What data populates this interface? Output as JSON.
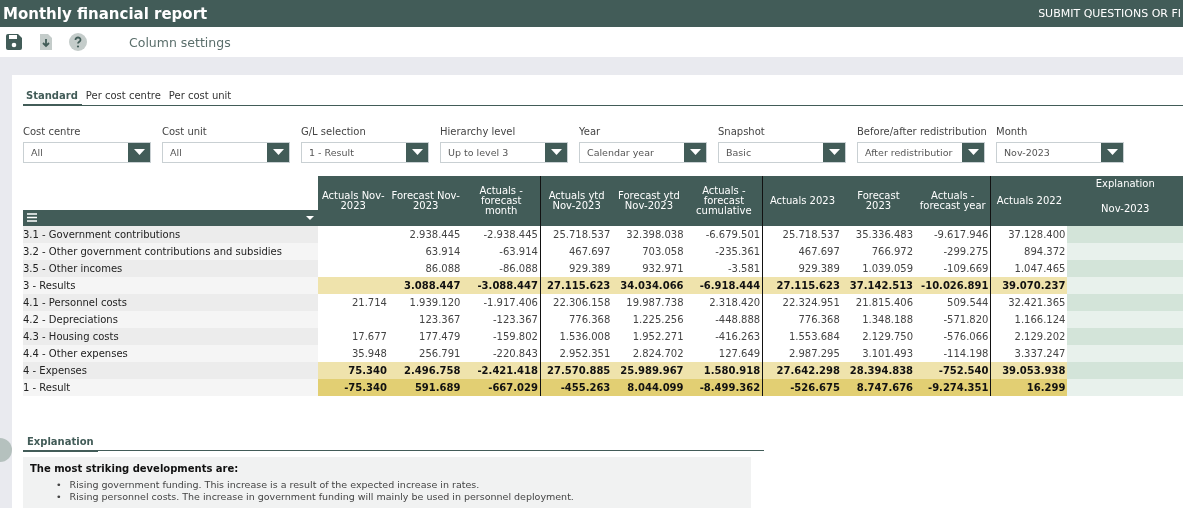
{
  "window": {
    "title": "Monthly financial report",
    "header_link": "SUBMIT QUESTIONS OR FI"
  },
  "toolbar": {
    "column_settings": "Column settings"
  },
  "tabs": [
    {
      "label": "Standard",
      "selected": true
    },
    {
      "label": "Per cost centre",
      "selected": false
    },
    {
      "label": "Per cost unit",
      "selected": false
    }
  ],
  "filters": [
    {
      "label": "Cost centre",
      "value": "All"
    },
    {
      "label": "Cost unit",
      "value": "All"
    },
    {
      "label": "G/L selection",
      "value": "1 - Result"
    },
    {
      "label": "Hierarchy level",
      "value": "Up to level 3"
    },
    {
      "label": "Year",
      "value": "Calendar year"
    },
    {
      "label": "Snapshot",
      "value": "Basic"
    },
    {
      "label": "Before/after redistribution",
      "value": "After redistributior"
    },
    {
      "label": "Month",
      "value": "Nov-2023"
    }
  ],
  "table": {
    "columns": [
      {
        "label": "Actuals Nov-2023",
        "divider": false
      },
      {
        "label": "Forecast Nov-2023",
        "divider": false
      },
      {
        "label": "Actuals - forecast month",
        "divider": true
      },
      {
        "label": "Actuals ytd Nov-2023",
        "divider": false
      },
      {
        "label": "Forecast ytd Nov-2023",
        "divider": false
      },
      {
        "label": "Actuals - forecast cumulative",
        "divider": true
      },
      {
        "label": "Actuals 2023",
        "divider": false
      },
      {
        "label": "Forecast 2023",
        "divider": false
      },
      {
        "label": "Actuals - forecast year",
        "divider": true
      },
      {
        "label": "Actuals 2022",
        "divider": false
      }
    ],
    "explanation_header": {
      "title": "Explanation",
      "subtitle": "Nov-2023"
    },
    "rows": [
      {
        "label": "3.1 - Government contributions",
        "kind": "detail",
        "cells": {
          "column_2": "2.938.445",
          "column_3": "-2.938.445",
          "column_4": "25.718.537",
          "column_5": "32.398.038",
          "column_6": "-6.679.501",
          "column_7": "25.718.537",
          "column_8": "35.336.483",
          "column_9": "-9.617.946",
          "column_10": "37.128.400"
        }
      },
      {
        "label": "3.2 - Other government contributions and subsidies",
        "kind": "detail",
        "cells": {
          "column_2": "63.914",
          "column_3": "-63.914",
          "column_4": "467.697",
          "column_5": "703.058",
          "column_6": "-235.361",
          "column_7": "467.697",
          "column_8": "766.972",
          "column_9": "-299.275",
          "column_10": "894.372"
        }
      },
      {
        "label": "3.5 - Other incomes",
        "kind": "detail",
        "cells": {
          "column_2": "86.088",
          "column_3": "-86.088",
          "column_4": "929.389",
          "column_5": "932.971",
          "column_6": "-3.581",
          "column_7": "929.389",
          "column_8": "1.039.059",
          "column_9": "-109.669",
          "column_10": "1.047.465"
        }
      },
      {
        "label": "3 - Results",
        "kind": "subtotal",
        "cells": {
          "column_2": "3.088.447",
          "column_3": "-3.088.447",
          "column_4": "27.115.623",
          "column_5": "34.034.066",
          "column_6": "-6.918.444",
          "column_7": "27.115.623",
          "column_8": "37.142.513",
          "column_9": "-10.026.891",
          "column_10": "39.070.237"
        }
      },
      {
        "label": "4.1 - Personnel costs",
        "kind": "detail",
        "cells": {
          "column_1": "21.714",
          "column_2": "1.939.120",
          "column_3": "-1.917.406",
          "column_4": "22.306.158",
          "column_5": "19.987.738",
          "column_6": "2.318.420",
          "column_7": "22.324.951",
          "column_8": "21.815.406",
          "column_9": "509.544",
          "column_10": "32.421.365"
        }
      },
      {
        "label": "4.2 - Depreciations",
        "kind": "detail",
        "cells": {
          "column_2": "123.367",
          "column_3": "-123.367",
          "column_4": "776.368",
          "column_5": "1.225.256",
          "column_6": "-448.888",
          "column_7": "776.368",
          "column_8": "1.348.188",
          "column_9": "-571.820",
          "column_10": "1.166.124"
        }
      },
      {
        "label": "4.3 - Housing costs",
        "kind": "detail",
        "cells": {
          "column_1": "17.677",
          "column_2": "177.479",
          "column_3": "-159.802",
          "column_4": "1.536.008",
          "column_5": "1.952.271",
          "column_6": "-416.263",
          "column_7": "1.553.684",
          "column_8": "2.129.750",
          "column_9": "-576.066",
          "column_10": "2.129.202"
        }
      },
      {
        "label": "4.4 - Other expenses",
        "kind": "detail",
        "cells": {
          "column_1": "35.948",
          "column_2": "256.791",
          "column_3": "-220.843",
          "column_4": "2.952.351",
          "column_5": "2.824.702",
          "column_6": "127.649",
          "column_7": "2.987.295",
          "column_8": "3.101.493",
          "column_9": "-114.198",
          "column_10": "3.337.247"
        }
      },
      {
        "label": "4 - Expenses",
        "kind": "subtotal",
        "cells": {
          "column_1": "75.340",
          "column_2": "2.496.758",
          "column_3": "-2.421.418",
          "column_4": "27.570.885",
          "column_5": "25.989.967",
          "column_6": "1.580.918",
          "column_7": "27.642.298",
          "column_8": "28.394.838",
          "column_9": "-752.540",
          "column_10": "39.053.938"
        }
      },
      {
        "label": "1 - Result",
        "kind": "total",
        "cells": {
          "column_1": "-75.340",
          "column_2": "591.689",
          "column_3": "-667.029",
          "column_4": "-455.263",
          "column_5": "8.044.099",
          "column_6": "-8.499.362",
          "column_7": "-526.675",
          "column_8": "8.747.676",
          "column_9": "-9.274.351",
          "column_10": "16.299"
        }
      }
    ]
  },
  "explanation": {
    "tab": "Explanation",
    "heading": "The most striking developments are:",
    "bullets": [
      {
        "marker": "•",
        "text": "Rising government funding. This increase is a result of the expected increase in rates."
      },
      {
        "marker": "•",
        "text": "Rising personnel costs. The increase in government funding will mainly be used in personnel deployment."
      }
    ]
  }
}
